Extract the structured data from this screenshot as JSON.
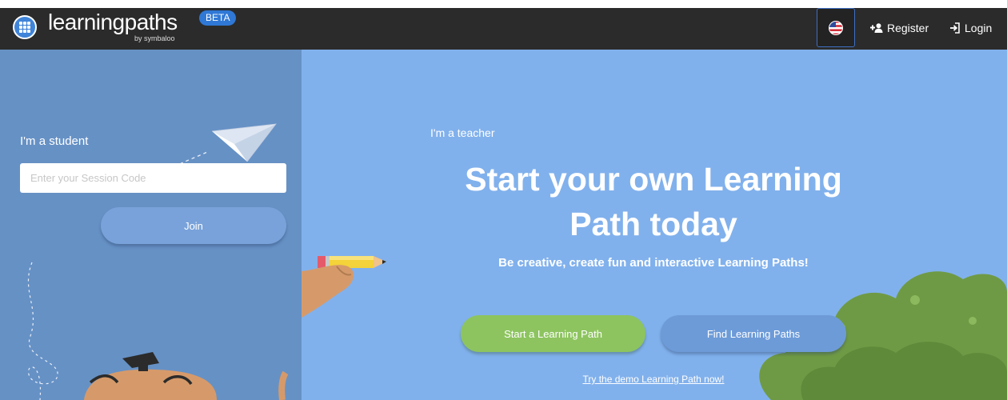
{
  "header": {
    "brand": "learningpaths",
    "brand_sub": "by symbaloo",
    "badge": "BETA",
    "register_label": "Register",
    "login_label": "Login"
  },
  "student": {
    "label": "I'm a student",
    "session_placeholder": "Enter your Session Code",
    "join_label": "Join"
  },
  "teacher": {
    "label": "I'm a teacher",
    "title": "Start your own Learning Path today",
    "subtitle": "Be creative, create fun and interactive Learning Paths!",
    "start_label": "Start a Learning Path",
    "find_label": "Find Learning Paths",
    "demo_link": "Try the demo Learning Path now!"
  },
  "icons": {
    "logo": "grid-dots-icon",
    "language": "us-flag-icon",
    "register": "user-plus-icon",
    "login": "sign-in-icon"
  },
  "colors": {
    "topbar": "#2b2b2b",
    "student_panel": "#6691c5",
    "teacher_panel": "#81b1ec",
    "start_button": "#8dc45f",
    "find_button": "#6d9bd8",
    "beta_badge": "#2f78d6"
  }
}
